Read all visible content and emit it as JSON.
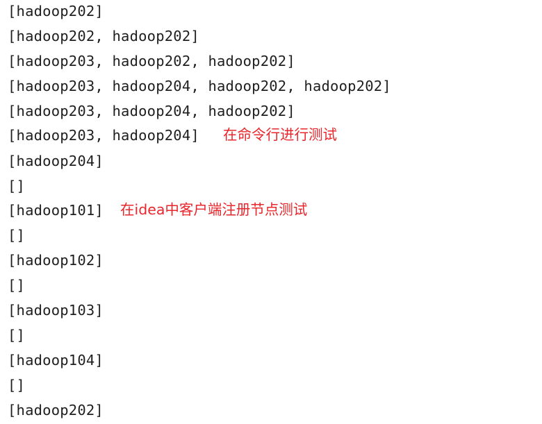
{
  "console": {
    "lines": [
      "[hadoop202]",
      "[hadoop202, hadoop202]",
      "[hadoop203, hadoop202, hadoop202]",
      "[hadoop203, hadoop204, hadoop202, hadoop202]",
      "[hadoop203, hadoop204, hadoop202]",
      "[hadoop203, hadoop204]",
      "[hadoop204]",
      "[]",
      "[hadoop101]",
      "[]",
      "[hadoop102]",
      "[]",
      "[hadoop103]",
      "[]",
      "[hadoop104]",
      "[]",
      "[hadoop202]"
    ],
    "annotations": {
      "cli_test": "在命令行进行测试",
      "idea_test": "在idea中客户端注册节点测试"
    },
    "colors": {
      "text": "#1e1e1e",
      "annotation": "#e8262b",
      "background": "#ffffff"
    }
  }
}
